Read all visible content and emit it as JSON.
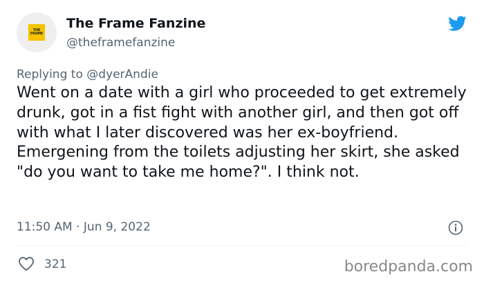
{
  "tweet": {
    "author_name": "The Frame Fanzine",
    "author_handle": "@theframefanzine",
    "avatar_logo_line1": "THE",
    "avatar_logo_line2": "FRAME",
    "replying_to": "Replying to @dyerAndie",
    "body": "Went on a date with a girl who proceeded to get extremely drunk, got in a fist fight with another girl, and then got off with what I later discovered was her ex-boyfriend. Emergening from the toilets adjusting her skirt, she asked \"do you want to take me home?\". I think not.",
    "timestamp": "11:50 AM · Jun 9, 2022",
    "like_count": "321"
  },
  "watermark": "boredpanda.com",
  "icons": {
    "brand": "twitter-bird-icon",
    "info": "info-icon",
    "like": "heart-icon"
  },
  "colors": {
    "twitter_blue": "#1d9bf0",
    "text": "#0f1419",
    "secondary_text": "#536471",
    "avatar_logo": "#f4c400"
  }
}
